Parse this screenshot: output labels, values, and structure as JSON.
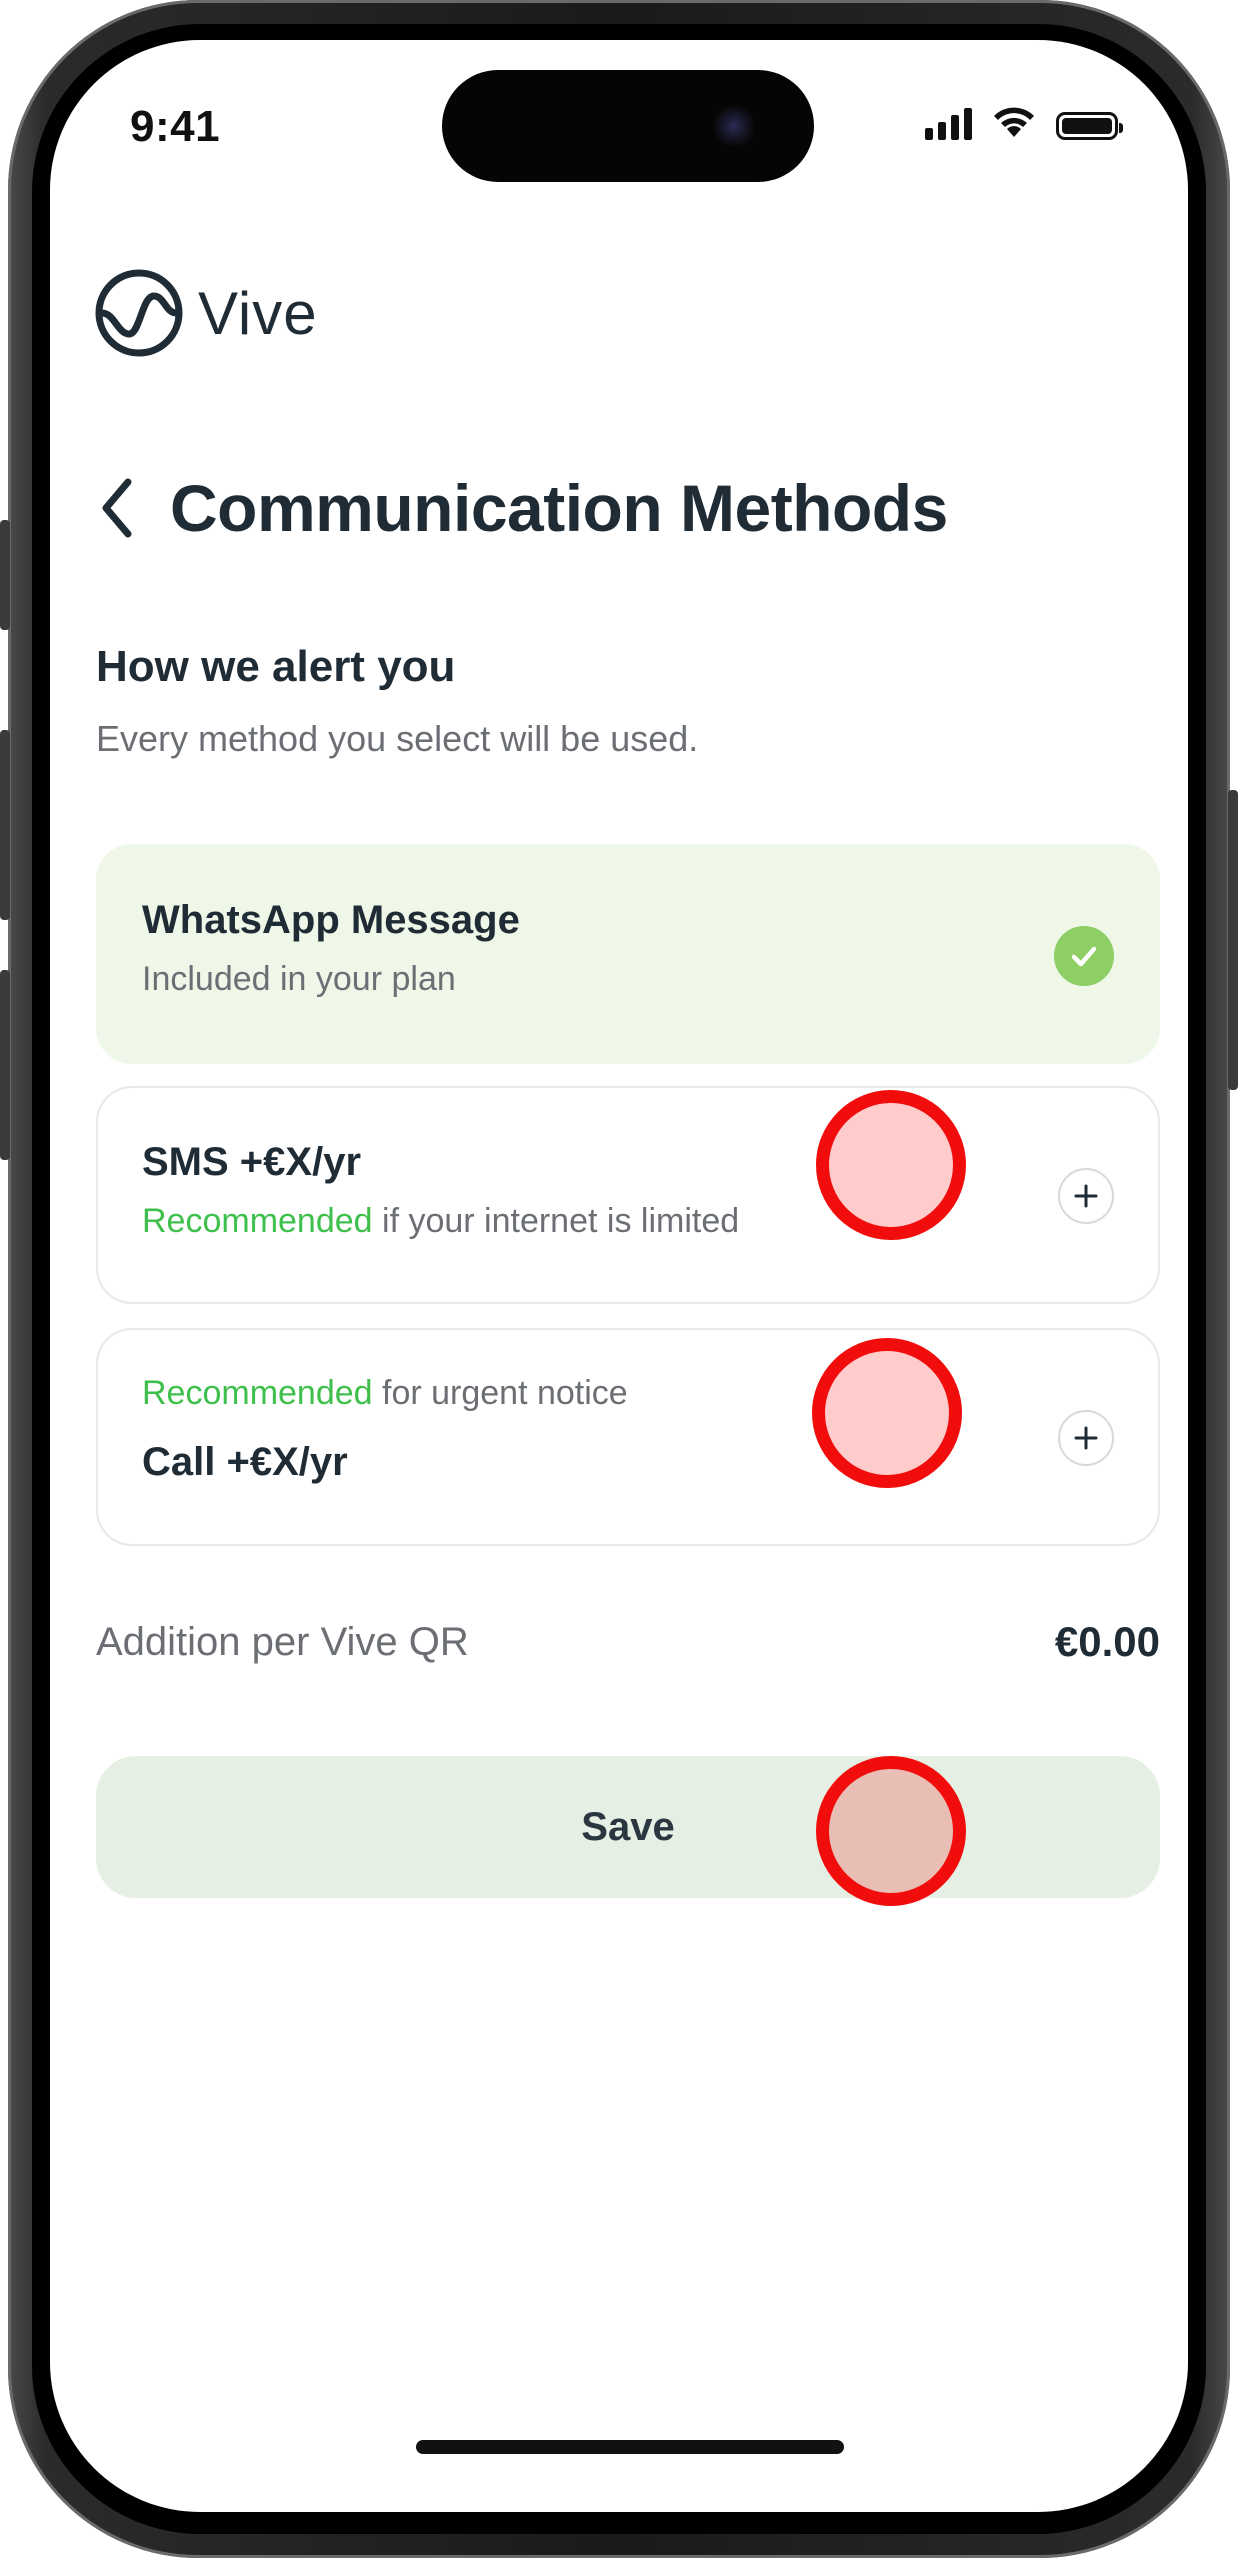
{
  "status_bar": {
    "time": "9:41",
    "icons": [
      "cellular-signal-icon",
      "wifi-icon",
      "battery-icon"
    ]
  },
  "brand": {
    "name": "Vive",
    "logo_icon": "vive-logo-icon",
    "color": "#1f2b35"
  },
  "header": {
    "title": "Communication Methods",
    "back_icon": "chevron-left-icon"
  },
  "section": {
    "heading": "How we alert you",
    "subtitle": "Every method you select will be used."
  },
  "methods": [
    {
      "title": "WhatsApp Message",
      "subtitle": "Included in your plan",
      "state": "included",
      "icon": "check-circle-icon"
    },
    {
      "title": "SMS +€X/yr",
      "badge": "Recommended",
      "subtitle_rest": " if your internet is limited",
      "state": "addable",
      "icon": "plus-icon"
    },
    {
      "badge": "Recommended",
      "subtitle_rest": " for urgent notice",
      "title": "Call +€X/yr",
      "state": "addable",
      "icon": "plus-icon"
    }
  ],
  "summary": {
    "label": "Addition per Vive QR",
    "value": "€0.00"
  },
  "save_button": {
    "label": "Save"
  },
  "colors": {
    "accent_green": "#3fbf4c",
    "included_bg": "#eff7e8",
    "check_green": "#8fce64",
    "save_bg": "#e6efe3",
    "tap_marker": "#f20d0d"
  }
}
